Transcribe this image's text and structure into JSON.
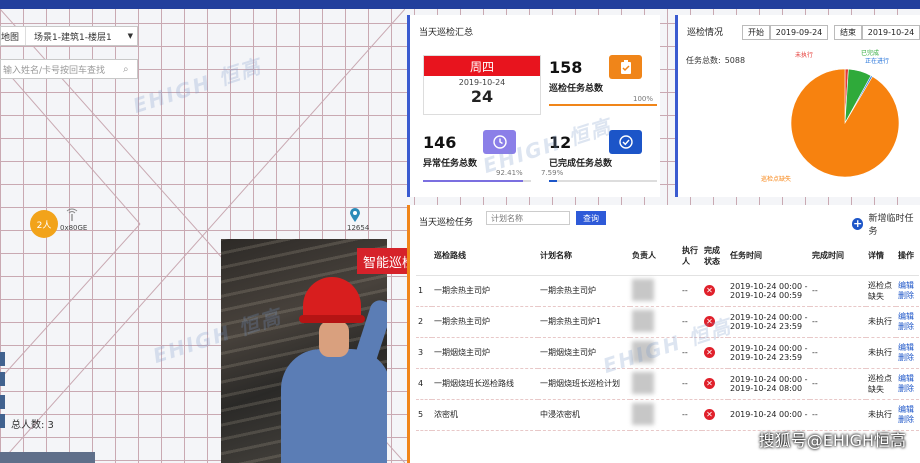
{
  "map": {
    "view_label": "地图",
    "scene_select": "场景1-建筑1-楼层1",
    "search_placeholder": "输入姓名/卡号按回车查找",
    "cluster_count": "2人",
    "beacon_id": "0x80GE",
    "pin_id": "12654",
    "total_people": "总人数: 3"
  },
  "video": {
    "tag": "智能巡检"
  },
  "summary": {
    "title": "当天巡检汇总",
    "weekday": "周四",
    "date": "2019-10-24",
    "day": "24",
    "total_tasks": {
      "value": "158",
      "label": "巡检任务总数",
      "percent_text": "100%",
      "percent": 1.0,
      "color": "#f08519"
    },
    "abnormal_tasks": {
      "value": "146",
      "label": "异常任务总数",
      "percent_text": "92.41%",
      "percent": 0.9241,
      "color": "#7b6fe0"
    },
    "completed_tasks": {
      "value": "12",
      "label": "已完成任务总数",
      "percent_text": "7.59%",
      "percent": 0.0759,
      "color": "#1c55c8"
    }
  },
  "inspection": {
    "title": "巡检情况",
    "start_label": "开始",
    "start_date": "2019-09-24",
    "end_label": "结束",
    "end_date": "2019-10-24",
    "total_label": "任务总数:",
    "total_value": "5088",
    "chart_data": {
      "type": "pie",
      "labels": [
        "未执行",
        "已完成",
        "正在进行",
        "巡检点缺失"
      ],
      "values": [
        1,
        7,
        0.5,
        91.5
      ],
      "colors": [
        "#e53935",
        "#2faa3a",
        "#1e6fd9",
        "#f7820f"
      ]
    }
  },
  "tasks": {
    "title": "当天巡检任务",
    "plan_placeholder": "计划名称",
    "query_label": "查询",
    "add_label": "新增临时任务",
    "columns": [
      "",
      "巡检路线",
      "计划名称",
      "负责人",
      "执行人",
      "完成状态",
      "任务时间",
      "完成时间",
      "详情",
      "操作"
    ],
    "rows": [
      {
        "idx": "1",
        "route": "一期余热主司炉",
        "plan": "一期余热主司炉",
        "executor": "--",
        "time1": "2019-10-24 00:00 -",
        "time2": "2019-10-24 00:59",
        "done": "--",
        "detail": "巡检点缺失",
        "op1": "编辑",
        "op2": "删除"
      },
      {
        "idx": "2",
        "route": "一期余热主司炉",
        "plan": "一期余热主司炉1",
        "executor": "--",
        "time1": "2019-10-24 00:00 -",
        "time2": "2019-10-24 23:59",
        "done": "--",
        "detail": "未执行",
        "op1": "编辑",
        "op2": "删除"
      },
      {
        "idx": "3",
        "route": "一期烟烧主司炉",
        "plan": "一期烟烧主司炉",
        "executor": "--",
        "time1": "2019-10-24 00:00 -",
        "time2": "2019-10-24 23:59",
        "done": "--",
        "detail": "未执行",
        "op1": "编辑",
        "op2": "删除"
      },
      {
        "idx": "4",
        "route": "一期烟烧班长巡检路线",
        "plan": "一期烟烧班长巡检计划",
        "executor": "--",
        "time1": "2019-10-24 00:00 -",
        "time2": "2019-10-24 08:00",
        "done": "--",
        "detail": "巡检点缺失",
        "op1": "编辑",
        "op2": "删除"
      },
      {
        "idx": "5",
        "route": "浓密机",
        "plan": "中浸浓密机",
        "executor": "--",
        "time1": "2019-10-24 00:00 -",
        "time2": "",
        "done": "--",
        "detail": "未执行",
        "op1": "编辑",
        "op2": "删除"
      }
    ]
  },
  "watermark": "EHIGH 恒高",
  "credit": "搜狐号@EHIGH恒高"
}
